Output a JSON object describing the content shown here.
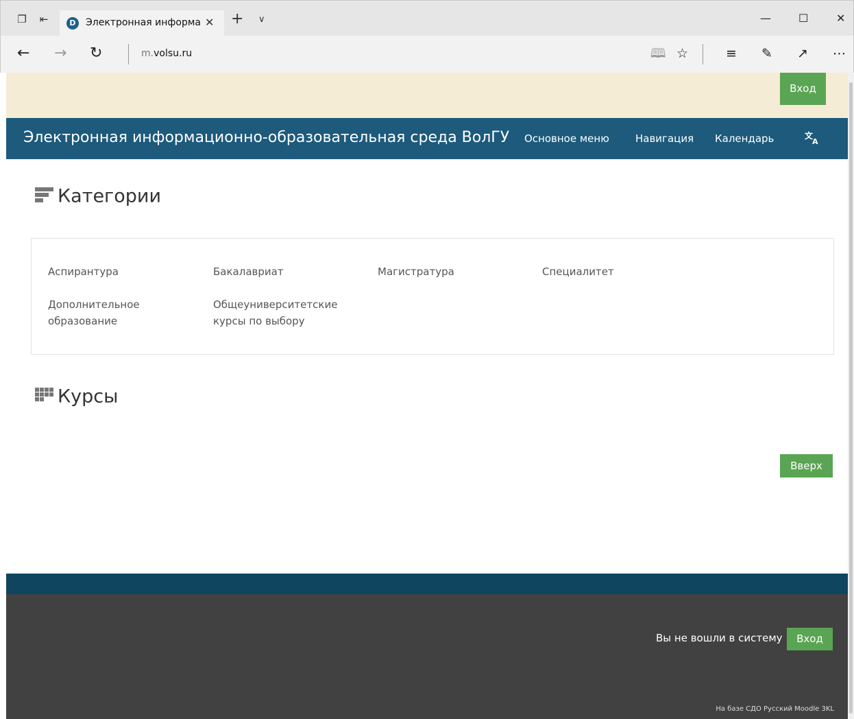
{
  "browser": {
    "tab_title": "Электронная информа",
    "tab_favicon": "D",
    "url_prefix": "m.",
    "url_domain": "volsu.ru"
  },
  "page": {
    "login_top_label": "Вход",
    "site_title": "Электронная информационно-образовательная среда ВолГУ",
    "nav": [
      {
        "label": "Основное меню"
      },
      {
        "label": "Навигация"
      },
      {
        "label": "Календарь"
      }
    ],
    "lang_icon": "translate-icon",
    "categories_heading": "Категории",
    "categories": [
      {
        "label": "Аспирантура"
      },
      {
        "label": "Бакалавриат"
      },
      {
        "label": "Магистратура"
      },
      {
        "label": "Специалитет"
      },
      {
        "label": "Дополнительное образование"
      },
      {
        "label": "Общеуниверситетские курсы по выбору"
      }
    ],
    "courses_heading": "Курсы",
    "up_label": "Вверх",
    "footer_msg": "Вы не вошли в систему",
    "login_bottom_label": "Вход",
    "powered_by": "На базе СДО Русский Moodle 3KL"
  },
  "colors": {
    "navbar": "#1d5a7c",
    "top_band": "#f5ecd6",
    "button_green": "#5aa553",
    "footer": "#414141",
    "footer_band": "#10455f"
  }
}
